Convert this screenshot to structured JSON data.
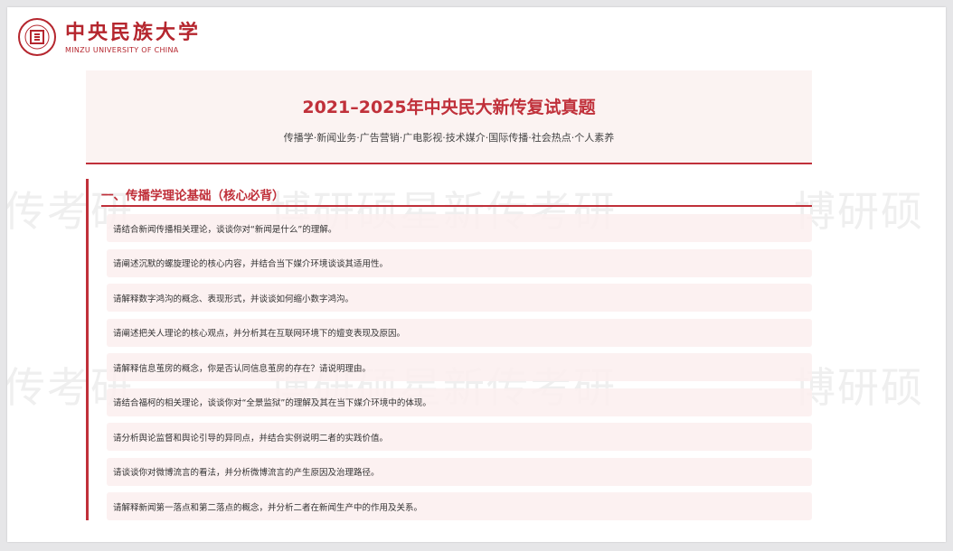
{
  "logo": {
    "name_cn": "中央民族大学",
    "name_en": "MINZU UNIVERSITY OF CHINA"
  },
  "header": {
    "title": "2021–2025年中央民大新传复试真题",
    "subtitle": "传播学·新闻业务·广告营销·广电影视·技术媒介·国际传播·社会热点·个人素养"
  },
  "watermark": {
    "text_1": "传考研",
    "text_2": "博研硕星新传考研",
    "text_3": "博研硕"
  },
  "section": {
    "heading": "一、传播学理论基础（核心必背）",
    "questions": [
      "请结合新闻传播相关理论，谈谈你对“新闻是什么”的理解。",
      "请阐述沉默的螺旋理论的核心内容，并结合当下媒介环境谈谈其适用性。",
      "请解释数字鸿沟的概念、表现形式，并谈谈如何缩小数字鸿沟。",
      "请阐述把关人理论的核心观点，并分析其在互联网环境下的嬗变表现及原因。",
      "请解释信息茧房的概念，你是否认同信息茧房的存在？请说明理由。",
      "请结合福柯的相关理论，谈谈你对“全景监狱”的理解及其在当下媒介环境中的体现。",
      "请分析舆论监督和舆论引导的异同点，并结合实例说明二者的实践价值。",
      "请谈谈你对微博流言的看法，并分析微博流言的产生原因及治理路径。",
      "请解释新闻第一落点和第二落点的概念，并分析二者在新闻生产中的作用及关系。"
    ]
  },
  "colors": {
    "accent": "#c0303a",
    "header_bg": "#fbf3f2",
    "item_bg": "#fbeeee"
  }
}
